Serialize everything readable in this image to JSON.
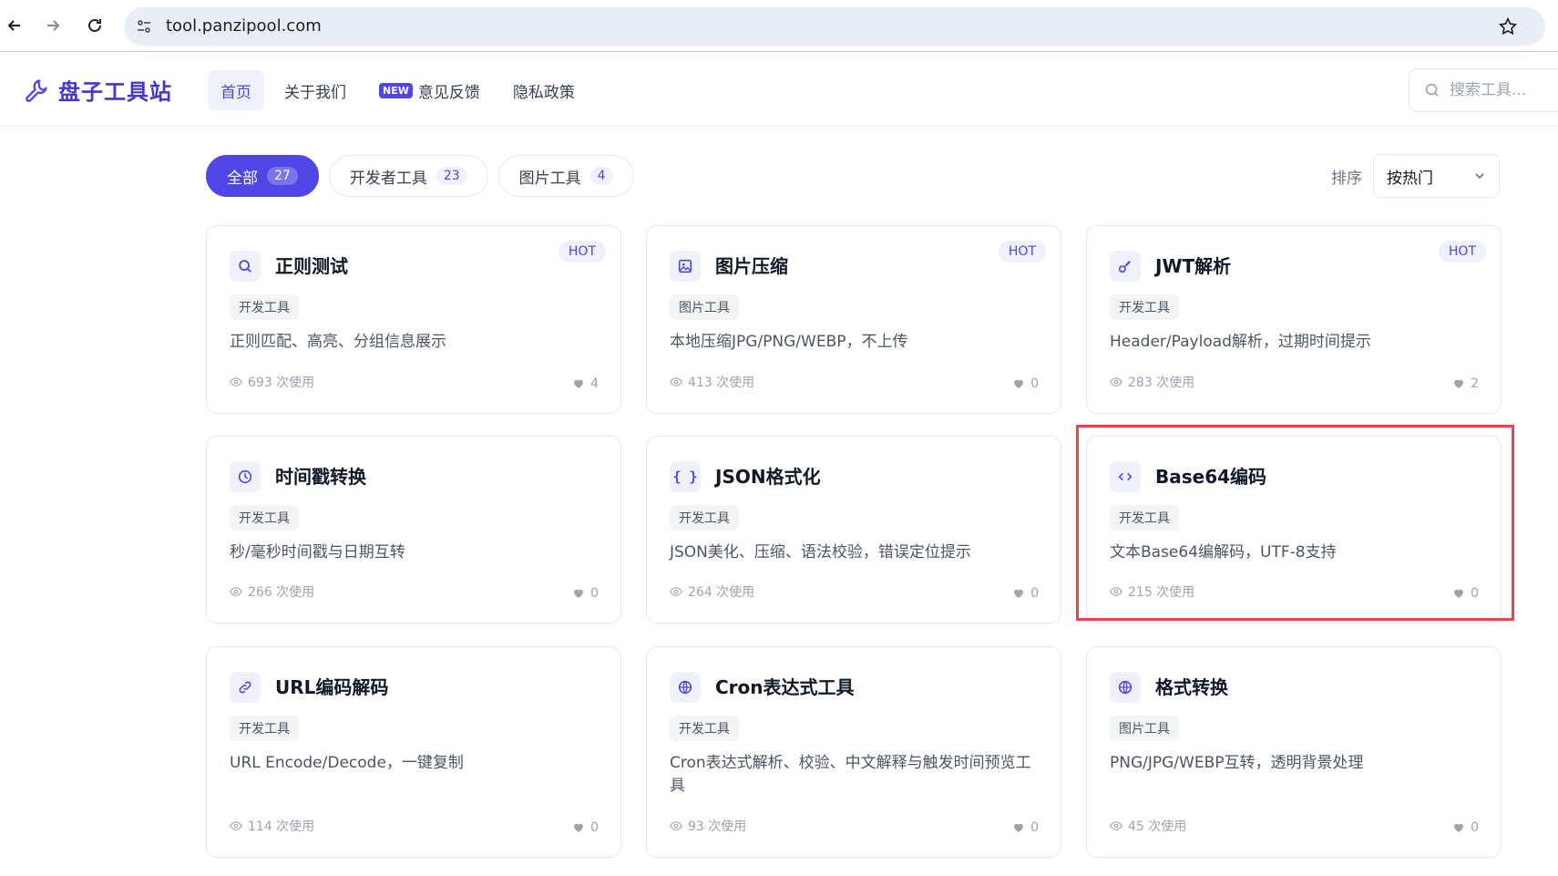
{
  "browser": {
    "url": "tool.panzipool.com"
  },
  "header": {
    "logo_text": "盘子工具站",
    "nav": [
      {
        "label": "首页",
        "active": true,
        "badge": ""
      },
      {
        "label": "关于我们",
        "active": false,
        "badge": ""
      },
      {
        "label": "意见反馈",
        "active": false,
        "badge": "NEW"
      },
      {
        "label": "隐私政策",
        "active": false,
        "badge": ""
      }
    ],
    "search_placeholder": "搜索工具..."
  },
  "filters": [
    {
      "label": "全部",
      "count": "27",
      "active": true
    },
    {
      "label": "开发者工具",
      "count": "23",
      "active": false
    },
    {
      "label": "图片工具",
      "count": "4",
      "active": false
    }
  ],
  "sort": {
    "label": "排序",
    "value": "按热门"
  },
  "cards": [
    {
      "title": "正则测试",
      "icon": "search-icon",
      "hot": "HOT",
      "tag": "开发工具",
      "desc": "正则匹配、高亮、分组信息展示",
      "uses": "693 次使用",
      "likes": "4"
    },
    {
      "title": "图片压缩",
      "icon": "image-icon",
      "hot": "HOT",
      "tag": "图片工具",
      "desc": "本地压缩JPG/PNG/WEBP，不上传",
      "uses": "413 次使用",
      "likes": "0"
    },
    {
      "title": "JWT解析",
      "icon": "key-icon",
      "hot": "HOT",
      "tag": "开发工具",
      "desc": "Header/Payload解析，过期时间提示",
      "uses": "283 次使用",
      "likes": "2"
    },
    {
      "title": "时间戳转换",
      "icon": "clock-icon",
      "hot": "",
      "tag": "开发工具",
      "desc": "秒/毫秒时间戳与日期互转",
      "uses": "266 次使用",
      "likes": "0"
    },
    {
      "title": "JSON格式化",
      "icon": "braces-icon",
      "hot": "",
      "tag": "开发工具",
      "desc": "JSON美化、压缩、语法校验，错误定位提示",
      "uses": "264 次使用",
      "likes": "0"
    },
    {
      "title": "Base64编码",
      "icon": "code-icon",
      "hot": "",
      "tag": "开发工具",
      "desc": "文本Base64编解码，UTF-8支持",
      "uses": "215 次使用",
      "likes": "0"
    },
    {
      "title": "URL编码解码",
      "icon": "link-icon",
      "hot": "",
      "tag": "开发工具",
      "desc": "URL Encode/Decode，一键复制",
      "uses": "114 次使用",
      "likes": "0"
    },
    {
      "title": "Cron表达式工具",
      "icon": "globe-icon",
      "hot": "",
      "tag": "开发工具",
      "desc": "Cron表达式解析、校验、中文解释与触发时间预览工具",
      "uses": "93 次使用",
      "likes": "0"
    },
    {
      "title": "格式转换",
      "icon": "globe-icon",
      "hot": "",
      "tag": "图片工具",
      "desc": "PNG/JPG/WEBP互转，透明背景处理",
      "uses": "45 次使用",
      "likes": "0"
    }
  ],
  "colors": {
    "accent": "#4f46e5",
    "highlight": "#ef4444"
  }
}
